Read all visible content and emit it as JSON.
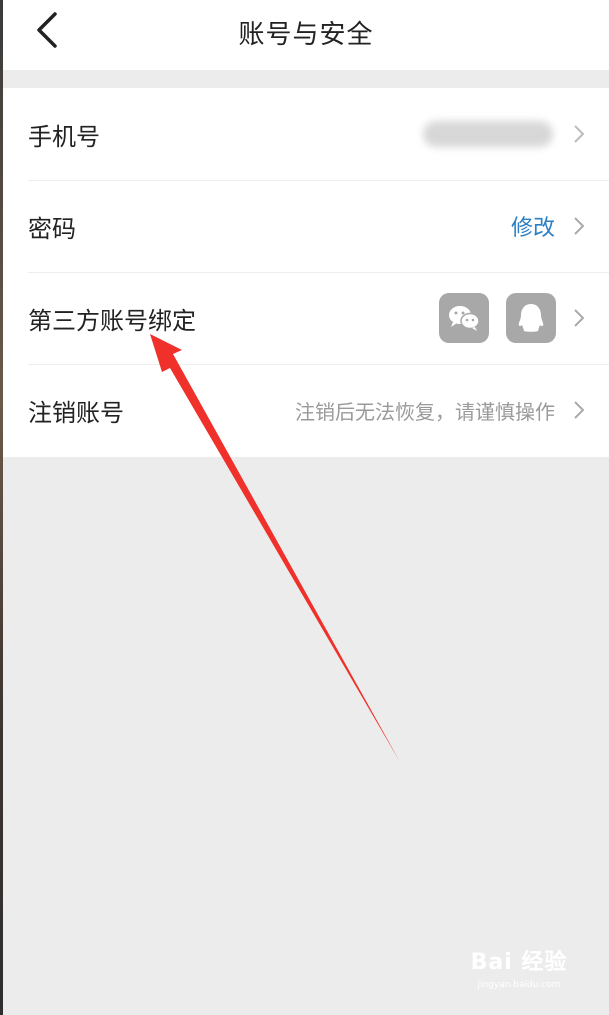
{
  "header": {
    "title": "账号与安全",
    "back_icon": "chevron-left-icon"
  },
  "rows": {
    "phone": {
      "label": "手机号"
    },
    "password": {
      "label": "密码",
      "action": "修改"
    },
    "third_party": {
      "label": "第三方账号绑定",
      "icons": [
        "wechat-icon",
        "qq-icon"
      ]
    },
    "cancel": {
      "label": "注销账号",
      "hint": "注销后无法恢复，请谨慎操作"
    }
  },
  "watermark": {
    "mark": "Bai 经验",
    "sub": "jingyan.baidu.com"
  },
  "colors": {
    "background": "#ececec",
    "link": "#2c7fc4",
    "hint": "#9a9a9a",
    "annotation_arrow": "#f0302a"
  }
}
